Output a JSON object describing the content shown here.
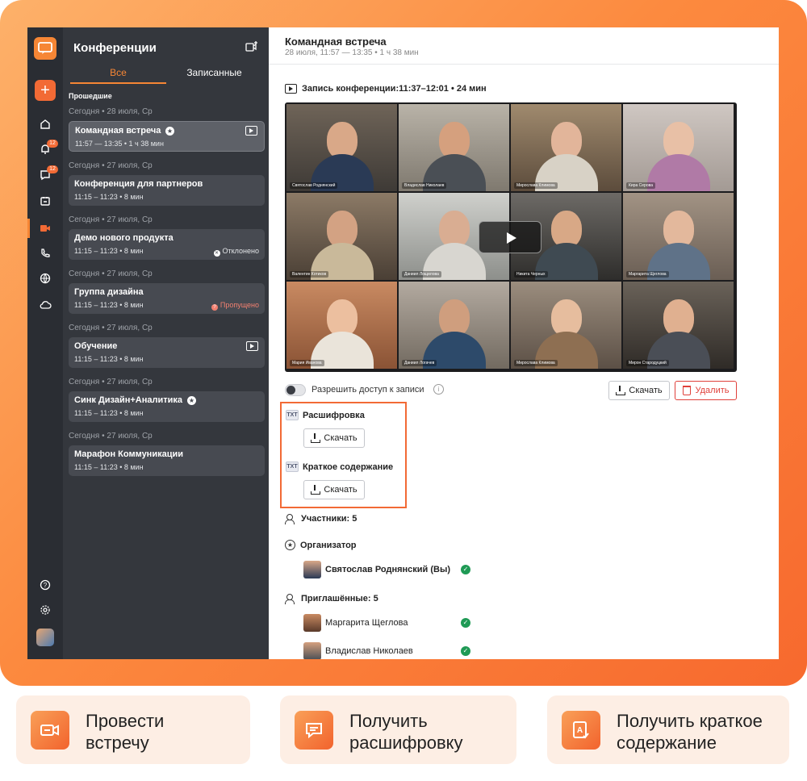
{
  "sidebar": {
    "title": "Конференции",
    "tabs": [
      "Все",
      "Записанные"
    ],
    "section": "Прошедшие",
    "badges": [
      "12",
      "12"
    ],
    "conferences": [
      {
        "date": "Сегодня • 28 июля, Ср",
        "title": "Командная встреча",
        "time": "11:57 — 13:35 • 1 ч 38 мин",
        "status": ""
      },
      {
        "date": "Сегодня • 27 июля, Ср",
        "title": "Конференция для партнеров",
        "time": "11:15 – 11:23 • 8 мин",
        "status": ""
      },
      {
        "date": "Сегодня • 27 июля, Ср",
        "title": "Демо нового продукта",
        "time": "11:15 – 11:23 • 8 мин",
        "status": "Отклонено"
      },
      {
        "date": "Сегодня • 27 июля, Ср",
        "title": "Группа дизайна",
        "time": "11:15 – 11:23 • 8 мин",
        "status": "Пропущено"
      },
      {
        "date": "Сегодня • 27 июля, Ср",
        "title": "Обучение",
        "time": "11:15 – 11:23 • 8 мин",
        "status": ""
      },
      {
        "date": "Сегодня • 27 июля, Ср",
        "title": "Синк Дизайн+Аналитика",
        "time": "11:15 – 11:23 • 8 мин",
        "status": ""
      },
      {
        "date": "Сегодня • 27 июля, Ср",
        "title": "Марафон Коммуникации",
        "time": "11:15 – 11:23 • 8 мин",
        "status": ""
      }
    ]
  },
  "main": {
    "title": "Командная встреча",
    "subtitle": "28 июля, 11:57 — 13:35 • 1 ч 38 мин",
    "recording_title": "Запись конференции:11:37–12:01 • 24 мин",
    "tiles": [
      "Святослав Роднянский",
      "Владислав Николаев",
      "Мирослава Климова",
      "Кира Серова",
      "Валентин Котиков",
      "Даниил Лощилова",
      "Никита Черных",
      "Маргарита Щеглова",
      "Мария Иванова",
      "Даниил Логачев",
      "Мирослава Климова",
      "Мирон Стародуцкий"
    ],
    "access_label": "Разрешить доступ к записи",
    "download_label": "Скачать",
    "delete_label": "Удалить",
    "transcript_label": "Расшифровка",
    "summary_label": "Краткое содержание",
    "txt_badge": "TXT",
    "participants_label": "Участники: 5",
    "organizer_label": "Организатор",
    "organizer_name": "Святослав Роднянский (Вы)",
    "invited_label": "Приглашённые: 5",
    "invited": [
      "Маргарита Щеглова",
      "Владислав Николаев"
    ]
  },
  "features": [
    {
      "text": "Провести\nвстречу",
      "icon": "video-camera-icon"
    },
    {
      "text": "Получить\nрасшифровку",
      "icon": "chat-bubble-icon"
    },
    {
      "text": "Получить краткое\nсодержание",
      "icon": "document-check-icon"
    }
  ],
  "colors": {
    "accent": "#f68635",
    "danger": "#e0403a",
    "success": "#1f9a55",
    "panel": "#34373d"
  }
}
